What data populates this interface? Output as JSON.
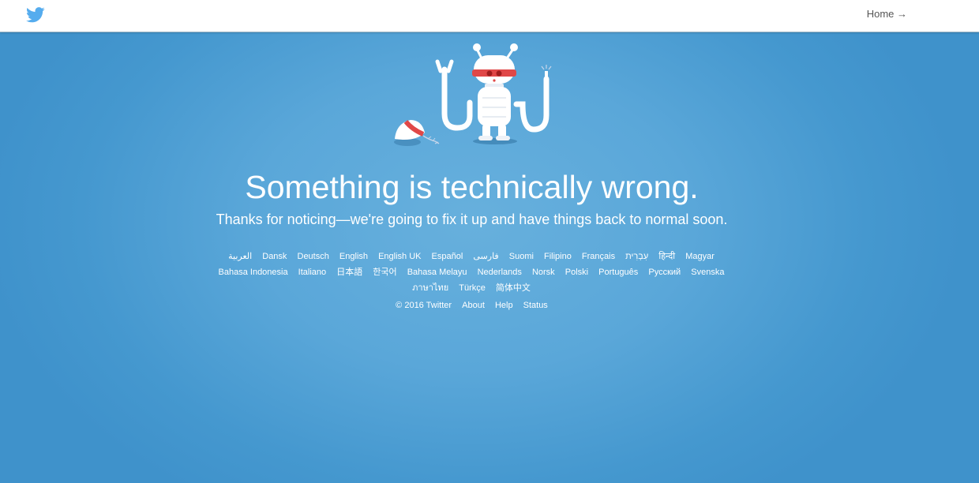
{
  "header": {
    "home_label": "Home →"
  },
  "error": {
    "title": "Something is technically wrong.",
    "message": "Thanks for noticing—we're going to fix it up and have things back to normal soon."
  },
  "languages": [
    "العربية",
    "Dansk",
    "Deutsch",
    "English",
    "English UK",
    "Español",
    "فارسی",
    "Suomi",
    "Filipino",
    "Français",
    "עִבְרִית",
    "हिन्दी",
    "Magyar",
    "Bahasa Indonesia",
    "Italiano",
    "日本語",
    "한국어",
    "Bahasa Melayu",
    "Nederlands",
    "Norsk",
    "Polski",
    "Português",
    "Русский",
    "Svenska",
    "ภาษาไทย",
    "Türkçe",
    "简体中文"
  ],
  "footer": {
    "copyright": "© 2016 Twitter",
    "about": "About",
    "help": "Help",
    "status": "Status"
  },
  "colors": {
    "brand": "#55acee",
    "background": "#5aa7d9",
    "text": "#ffffff"
  },
  "icons": {
    "logo": "twitter-bird-icon",
    "illustration": "robot-illustration"
  }
}
